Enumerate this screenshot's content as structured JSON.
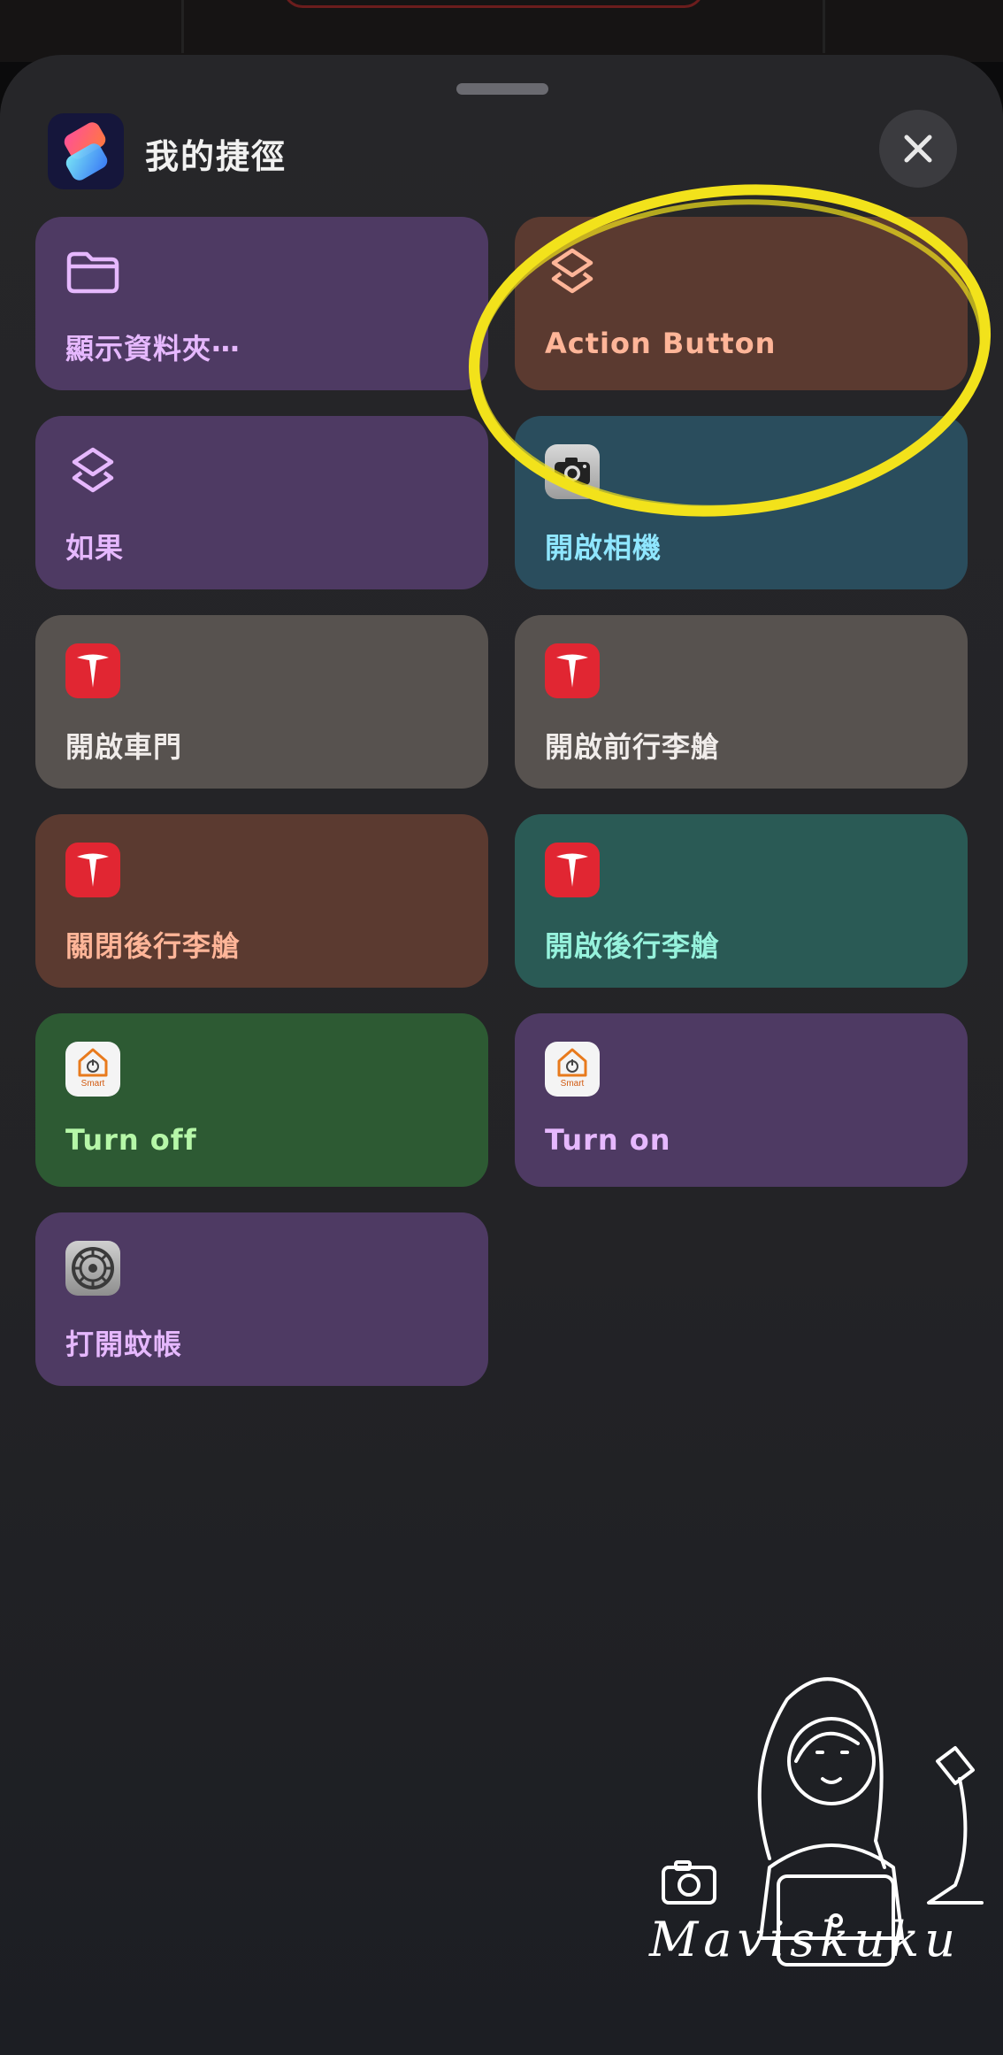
{
  "sheet": {
    "title": "我的捷徑",
    "close_icon": "close-icon",
    "app_icon": "shortcuts-app-icon"
  },
  "shortcuts": [
    {
      "id": "show-folder",
      "label": "顯示資料夾⋯",
      "icon": "folder-icon",
      "color": "#4e3a63"
    },
    {
      "id": "action-button",
      "label": "Action Button",
      "icon": "layers-icon",
      "color": "#5b3a30",
      "highlighted": true
    },
    {
      "id": "if",
      "label": "如果",
      "icon": "layers-icon",
      "color": "#4e3a63"
    },
    {
      "id": "open-camera",
      "label": "開啟相機",
      "icon": "camera-app-icon",
      "color": "#2a4d5d"
    },
    {
      "id": "open-door",
      "label": "開啟車門",
      "icon": "tesla-icon",
      "color": "#57524f"
    },
    {
      "id": "open-frunk",
      "label": "開啟前行李艙",
      "icon": "tesla-icon",
      "color": "#57524f"
    },
    {
      "id": "close-trunk",
      "label": "關閉後行李艙",
      "icon": "tesla-icon",
      "color": "#5b3a30"
    },
    {
      "id": "open-trunk",
      "label": "開啟後行李艙",
      "icon": "tesla-icon",
      "color": "#2a5a55"
    },
    {
      "id": "turn-off",
      "label": "Turn off",
      "icon": "smart-home-icon",
      "color": "#2d5a33"
    },
    {
      "id": "turn-on",
      "label": "Turn on",
      "icon": "smart-home-icon",
      "color": "#4e3a63"
    },
    {
      "id": "open-mosquito-net",
      "label": "打開蚊帳",
      "icon": "settings-icon",
      "color": "#4e3a63"
    }
  ],
  "smart_badge_text": "Smart",
  "annotation": {
    "shape": "yellow-ellipse",
    "color": "#f2e21b"
  },
  "watermark": {
    "signature": "Maviskuku",
    "icon": "girl-with-laptop-illustration"
  }
}
